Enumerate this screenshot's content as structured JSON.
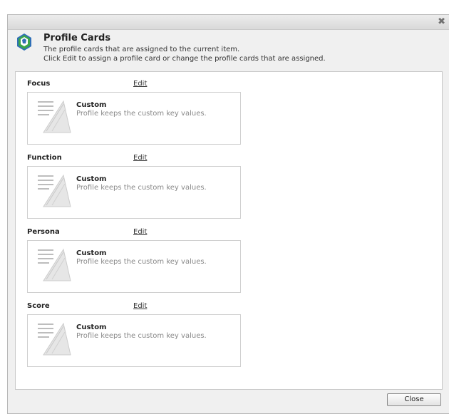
{
  "dialog": {
    "close_glyph": "✖",
    "title": "Profile Cards",
    "description_line1": "The profile cards that are assigned to the current item.",
    "description_line2": "Click Edit to assign a profile card or change the profile cards that are assigned.",
    "close_button_label": "Close"
  },
  "sections": [
    {
      "label": "Focus",
      "edit": "Edit",
      "card_title": "Custom",
      "card_desc": "Profile keeps the custom key values."
    },
    {
      "label": "Function",
      "edit": "Edit",
      "card_title": "Custom",
      "card_desc": "Profile keeps the custom key values."
    },
    {
      "label": "Persona",
      "edit": "Edit",
      "card_title": "Custom",
      "card_desc": "Profile keeps the custom key values."
    },
    {
      "label": "Score",
      "edit": "Edit",
      "card_title": "Custom",
      "card_desc": "Profile keeps the custom key values."
    }
  ],
  "icons": {
    "header": "profile-cards-icon",
    "card": "custom-profile-icon"
  },
  "colors": {
    "accent_green": "#3aa54a",
    "accent_blue": "#2f6fb7"
  }
}
